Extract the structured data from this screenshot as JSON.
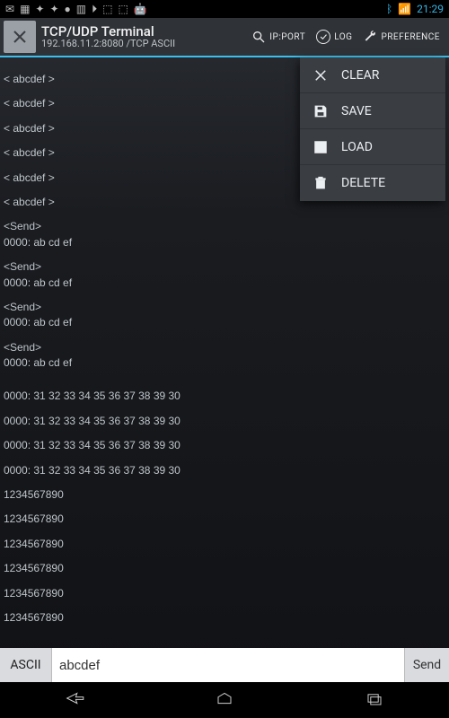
{
  "status_bar": {
    "left_icons": [
      "✉",
      "▦",
      "✦",
      "✦",
      "●",
      "▥",
      "⏵",
      "⬚",
      "⬚",
      "🤖"
    ],
    "bluetooth_icon": "ᛒ",
    "wifi_icon": "📶",
    "time": "21:29"
  },
  "app_bar": {
    "title": "TCP/UDP Terminal",
    "subtitle": "192.168.11.2:8080 /TCP  ASCII",
    "actions": {
      "ip_port": "IP:PORT",
      "log": "LOG",
      "preference": "PREFERENCE"
    }
  },
  "menu": {
    "clear": "CLEAR",
    "save": "SAVE",
    "load": "LOAD",
    "delete": "DELETE"
  },
  "terminal_lines": [
    "",
    "< abcdef >",
    "",
    "< abcdef >",
    "",
    "< abcdef >",
    "",
    "< abcdef >",
    "",
    "< abcdef >",
    "",
    "< abcdef >",
    "",
    "<Send>",
    "0000: ab cd ef",
    "",
    "<Send>",
    "0000: ab cd ef",
    "",
    "<Send>",
    "0000: ab cd ef",
    "",
    "<Send>",
    "0000: ab cd ef",
    "",
    "",
    "0000: 31 32 33 34 35 36 37 38 39 30",
    "",
    "0000: 31 32 33 34 35 36 37 38 39 30",
    "",
    "0000: 31 32 33 34 35 36 37 38 39 30",
    "",
    "0000: 31 32 33 34 35 36 37 38 39 30",
    "",
    "1234567890",
    "",
    "1234567890",
    "",
    "1234567890",
    "",
    "1234567890",
    "",
    "1234567890",
    "",
    "1234567890"
  ],
  "input_row": {
    "mode": "ASCII",
    "value": "abcdef",
    "send": "Send"
  },
  "colors": {
    "accent": "#33b5e5",
    "panel": "#3a3d42"
  }
}
